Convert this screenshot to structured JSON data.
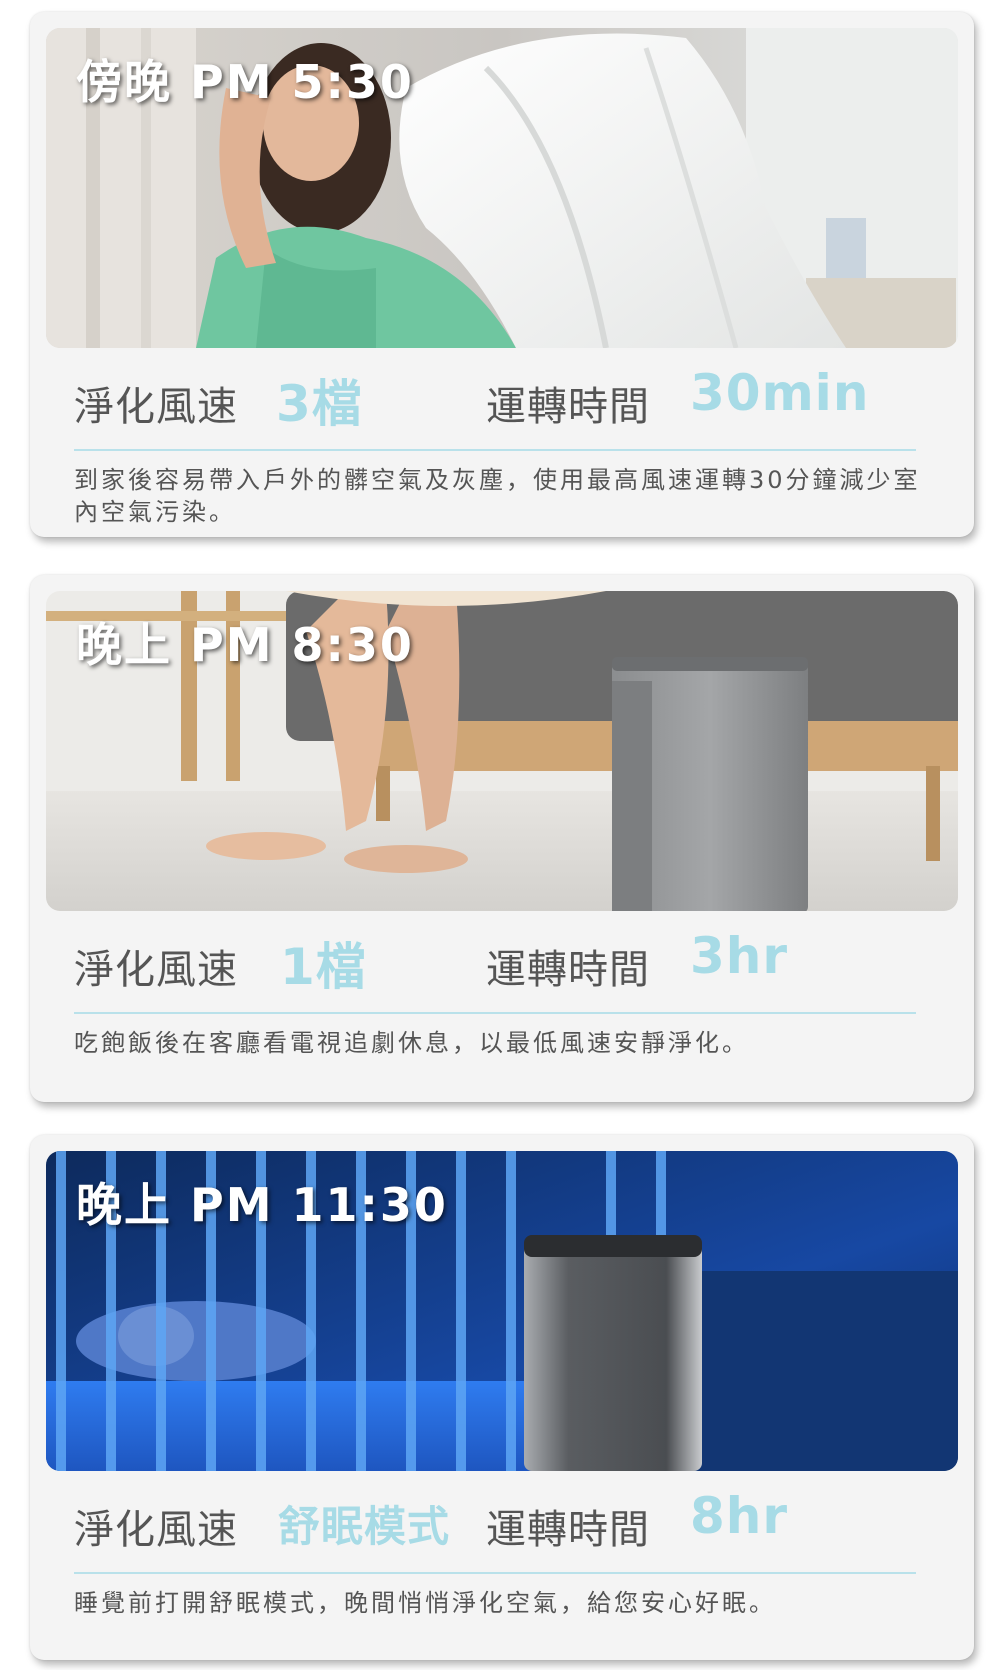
{
  "scenes": [
    {
      "time": "傍晚 PM 5:30",
      "speed_label": "淨化風速",
      "speed_value": "3檔",
      "duration_label": "運轉時間",
      "duration_value": "30min",
      "description": "到家後容易帶入戶外的髒空氣及灰塵，使用最高風速運轉30分鐘減少室內空氣污染。"
    },
    {
      "time": "晚上 PM 8:30",
      "speed_label": "淨化風速",
      "speed_value": "1檔",
      "duration_label": "運轉時間",
      "duration_value": "3hr",
      "description": "吃飽飯後在客廳看電視追劇休息，以最低風速安靜淨化。"
    },
    {
      "time": "晚上 PM 11:30",
      "speed_label": "淨化風速",
      "speed_value": "舒眠模式",
      "duration_label": "運轉時間",
      "duration_value": "8hr",
      "description": "睡覺前打開舒眠模式，晚間悄悄淨化空氣，給您安心好眠。"
    }
  ],
  "colors": {
    "accent": "#a7dbe6",
    "label_text": "#555555",
    "card_bg": "#f4f4f4"
  }
}
